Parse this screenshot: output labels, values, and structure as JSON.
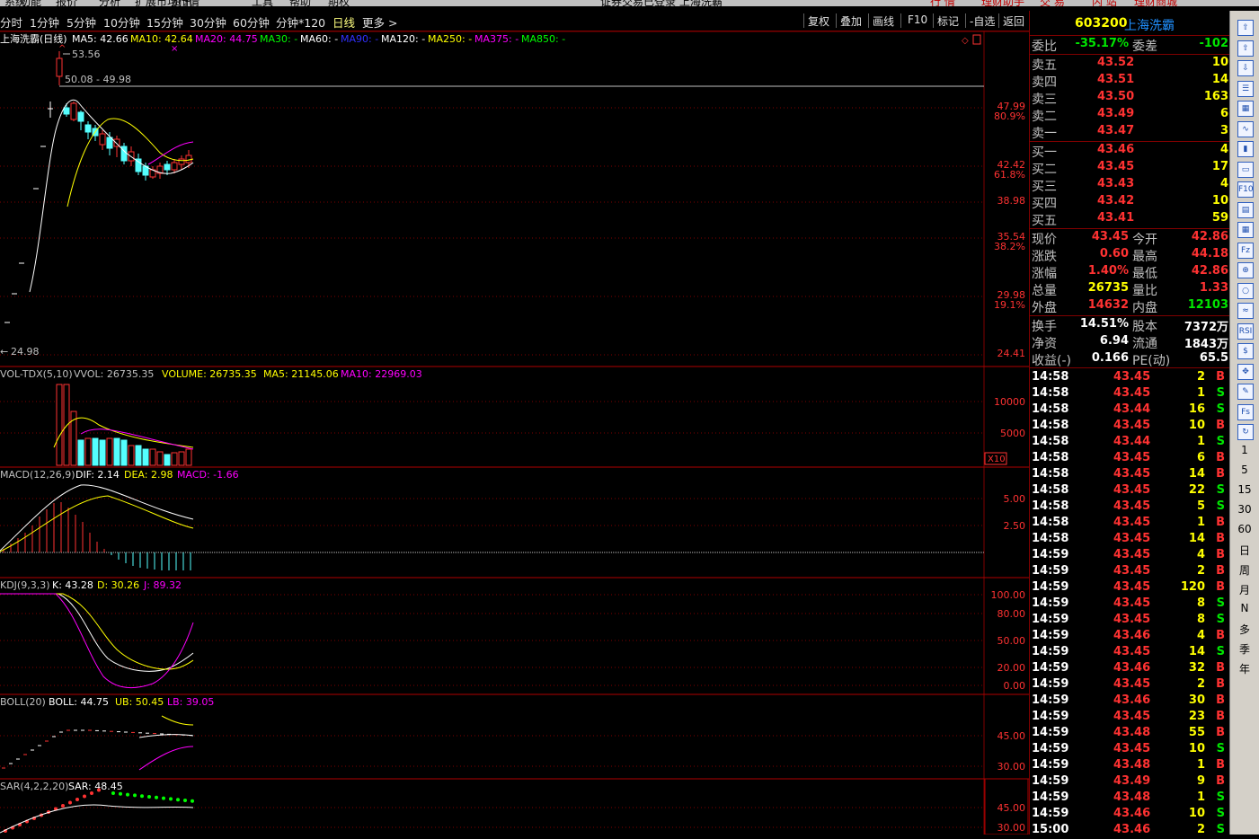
{
  "menubar": {
    "items": [
      "系统",
      "功能",
      "报价",
      "分析",
      "扩展市场行情",
      "资讯",
      "工具",
      "帮助",
      "期权"
    ],
    "title": "证券交易已登录    上海洗霸",
    "right_buttons": [
      "行 情",
      "理财助手",
      "交 易",
      "内 站",
      "理财商城"
    ]
  },
  "periods": {
    "items": [
      "分时",
      "1分钟",
      "5分钟",
      "10分钟",
      "15分钟",
      "30分钟",
      "60分钟",
      "分钟*120",
      "日线",
      "更多 >"
    ],
    "active": "日线"
  },
  "toolbar": {
    "items": [
      "复权",
      "叠加",
      "画线",
      "F10",
      "标记",
      "-自选",
      "返回"
    ]
  },
  "main_panel": {
    "title": "上海洗霸(日线)",
    "ma_items": [
      {
        "label": "MA5: 42.66",
        "color": "#ffffff"
      },
      {
        "label": "MA10: 42.64",
        "color": "#ffff00"
      },
      {
        "label": "MA20: 44.75",
        "color": "#ff00ff"
      },
      {
        "label": "MA30: -",
        "color": "#00ff00"
      },
      {
        "label": "MA60: -",
        "color": "#ffffff"
      },
      {
        "label": "MA90: -",
        "color": "#3030ff"
      },
      {
        "label": "MA120: -",
        "color": "#ffffff"
      },
      {
        "label": "MA250: -",
        "color": "#ffff00"
      },
      {
        "label": "MA375: -",
        "color": "#ff00ff"
      },
      {
        "label": "MA850: -",
        "color": "#00ff00"
      }
    ],
    "high_label": "53.56",
    "range_label": "50.08 - 49.98",
    "low_label": "24.98",
    "axis": [
      {
        "price": "47.99",
        "pct": "80.9%"
      },
      {
        "price": "42.42",
        "pct": "61.8%"
      },
      {
        "price": "38.98",
        "pct": ""
      },
      {
        "price": "35.54",
        "pct": "38.2%"
      },
      {
        "price": "29.98",
        "pct": "19.1%"
      },
      {
        "price": "24.41",
        "pct": ""
      }
    ]
  },
  "vol_panel": {
    "title": "VOL-TDX(5,10)",
    "vvol": "VVOL: 26735.35",
    "volume": "VOLUME: 26735.35",
    "ma5": "MA5: 21145.06",
    "ma10": "MA10: 22969.03",
    "axis": [
      "10000",
      "5000"
    ],
    "unit": "X10"
  },
  "macd_panel": {
    "title": "MACD(12,26,9)",
    "dif": "DIF: 2.14",
    "dea": "DEA: 2.98",
    "macd": "MACD: -1.66",
    "axis": [
      "5.00",
      "2.50"
    ]
  },
  "kdj_panel": {
    "title": "KDJ(9,3,3)",
    "k": "K: 43.28",
    "d": "D: 30.26",
    "j": "J: 89.32",
    "axis": [
      "100.00",
      "80.00",
      "50.00",
      "20.00",
      "0.00"
    ]
  },
  "boll_panel": {
    "title": "BOLL(20)",
    "boll": "BOLL: 44.75",
    "ub": "UB: 50.45",
    "lb": "LB: 39.05",
    "axis": [
      "45.00",
      "30.00"
    ]
  },
  "sar_panel": {
    "title": "SAR(4,2,2,20)",
    "sar": "SAR: 48.45",
    "axis": [
      "45.00",
      "30.00"
    ]
  },
  "quote": {
    "code": "603200",
    "name": "上海洗霸",
    "webi_label": "委比",
    "webi_value": "-35.17%",
    "weicha_label": "委差",
    "weicha_value": "-102",
    "sell": [
      {
        "label": "卖五",
        "price": "43.52",
        "vol": "10"
      },
      {
        "label": "卖四",
        "price": "43.51",
        "vol": "14"
      },
      {
        "label": "卖三",
        "price": "43.50",
        "vol": "163"
      },
      {
        "label": "卖二",
        "price": "43.49",
        "vol": "6"
      },
      {
        "label": "卖一",
        "price": "43.47",
        "vol": "3"
      }
    ],
    "buy": [
      {
        "label": "买一",
        "price": "43.46",
        "vol": "4"
      },
      {
        "label": "买二",
        "price": "43.45",
        "vol": "17"
      },
      {
        "label": "买三",
        "price": "43.43",
        "vol": "4"
      },
      {
        "label": "买四",
        "price": "43.42",
        "vol": "10"
      },
      {
        "label": "买五",
        "price": "43.41",
        "vol": "59"
      }
    ],
    "stats": [
      {
        "l1": "现价",
        "v1": "43.45",
        "c1": "red",
        "l2": "今开",
        "v2": "42.86",
        "c2": "red"
      },
      {
        "l1": "涨跌",
        "v1": "0.60",
        "c1": "red",
        "l2": "最高",
        "v2": "44.18",
        "c2": "red"
      },
      {
        "l1": "涨幅",
        "v1": "1.40%",
        "c1": "red",
        "l2": "最低",
        "v2": "42.86",
        "c2": "red"
      },
      {
        "l1": "总量",
        "v1": "26735",
        "c1": "yel",
        "l2": "量比",
        "v2": "1.33",
        "c2": "red"
      },
      {
        "l1": "外盘",
        "v1": "14632",
        "c1": "red",
        "l2": "内盘",
        "v2": "12103",
        "c2": "grn"
      }
    ],
    "stats2": [
      {
        "l1": "换手",
        "v1": "14.51%",
        "l2": "股本",
        "v2": "7372万"
      },
      {
        "l1": "净资",
        "v1": "6.94",
        "l2": "流通",
        "v2": "1843万"
      },
      {
        "l1": "收益(-)",
        "v1": "0.166",
        "l2": "PE(动)",
        "v2": "65.5"
      }
    ],
    "ticks": [
      {
        "t": "14:58",
        "p": "43.45",
        "v": "2",
        "s": "B"
      },
      {
        "t": "14:58",
        "p": "43.45",
        "v": "1",
        "s": "S"
      },
      {
        "t": "14:58",
        "p": "43.44",
        "v": "16",
        "s": "S"
      },
      {
        "t": "14:58",
        "p": "43.45",
        "v": "10",
        "s": "B"
      },
      {
        "t": "14:58",
        "p": "43.44",
        "v": "1",
        "s": "S"
      },
      {
        "t": "14:58",
        "p": "43.45",
        "v": "6",
        "s": "B"
      },
      {
        "t": "14:58",
        "p": "43.45",
        "v": "14",
        "s": "B"
      },
      {
        "t": "14:58",
        "p": "43.45",
        "v": "22",
        "s": "S"
      },
      {
        "t": "14:58",
        "p": "43.45",
        "v": "5",
        "s": "S"
      },
      {
        "t": "14:58",
        "p": "43.45",
        "v": "1",
        "s": "B"
      },
      {
        "t": "14:58",
        "p": "43.45",
        "v": "14",
        "s": "B"
      },
      {
        "t": "14:59",
        "p": "43.45",
        "v": "4",
        "s": "B"
      },
      {
        "t": "14:59",
        "p": "43.45",
        "v": "2",
        "s": "B"
      },
      {
        "t": "14:59",
        "p": "43.45",
        "v": "120",
        "s": "B"
      },
      {
        "t": "14:59",
        "p": "43.45",
        "v": "8",
        "s": "S"
      },
      {
        "t": "14:59",
        "p": "43.45",
        "v": "8",
        "s": "S"
      },
      {
        "t": "14:59",
        "p": "43.46",
        "v": "4",
        "s": "B"
      },
      {
        "t": "14:59",
        "p": "43.45",
        "v": "14",
        "s": "S"
      },
      {
        "t": "14:59",
        "p": "43.46",
        "v": "32",
        "s": "B"
      },
      {
        "t": "14:59",
        "p": "43.45",
        "v": "2",
        "s": "B"
      },
      {
        "t": "14:59",
        "p": "43.46",
        "v": "30",
        "s": "B"
      },
      {
        "t": "14:59",
        "p": "43.45",
        "v": "23",
        "s": "B"
      },
      {
        "t": "14:59",
        "p": "43.48",
        "v": "55",
        "s": "B"
      },
      {
        "t": "14:59",
        "p": "43.45",
        "v": "10",
        "s": "S"
      },
      {
        "t": "14:59",
        "p": "43.48",
        "v": "1",
        "s": "B"
      },
      {
        "t": "14:59",
        "p": "43.49",
        "v": "9",
        "s": "B"
      },
      {
        "t": "14:59",
        "p": "43.48",
        "v": "1",
        "s": "S"
      },
      {
        "t": "14:59",
        "p": "43.46",
        "v": "10",
        "s": "S"
      },
      {
        "t": "15:00",
        "p": "43.46",
        "v": "2",
        "s": "S"
      }
    ]
  },
  "right_toolbar": {
    "text_items": [
      "1",
      "5",
      "15",
      "30",
      "60",
      "日",
      "周",
      "月",
      "N",
      "多",
      "季",
      "年"
    ],
    "icons": [
      "up-arrow-icon",
      "up-arrow-icon",
      "down-arrow-icon",
      "list-icon",
      "grid-icon",
      "line-chart-icon",
      "candle-icon",
      "window-icon",
      "f10-icon",
      "doc-icon",
      "calendar-icon",
      "fz-icon",
      "zoom-icon",
      "circle-icon",
      "wave-icon",
      "rsi-icon",
      "dollar-icon",
      "move-icon",
      "pen-icon",
      "fs-icon",
      "refresh-icon"
    ]
  }
}
